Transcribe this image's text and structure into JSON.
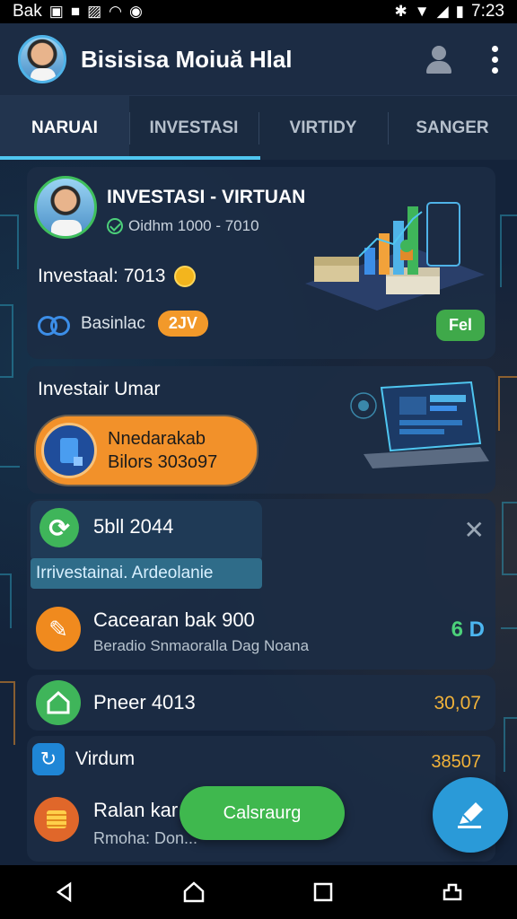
{
  "status_bar": {
    "carrier": "Bak",
    "time": "7:23"
  },
  "app_bar": {
    "title": "Bisisisa Moiuă Hlal"
  },
  "tabs": [
    {
      "label": "NARUAI",
      "active": true
    },
    {
      "label": "INVESTASI",
      "active": false
    },
    {
      "label": "VIRTIDY",
      "active": false
    },
    {
      "label": "SANGER",
      "active": false
    }
  ],
  "profile_card": {
    "title": "INVESTASI - VIRTUAN",
    "subtitle": "Oidhm 1000 - 7010",
    "amount": "Investaal: 7013",
    "bottom_label": "Basinlac",
    "orange_pill": "2JV",
    "green_pill": "Fel"
  },
  "invest_card": {
    "title": "Investair Umar",
    "button_line1": "Nnedarakab",
    "button_line2": "Bilors 303o97"
  },
  "activity_card": {
    "title": "5bll 2044",
    "banner": "Irrivestainai. Ardeolanie",
    "row_title": "Cacearan bak 900",
    "row_sub": "Beradio Snmaoralla Dag Noana",
    "badge_left": "6",
    "badge_right": "D"
  },
  "summary_row": {
    "label": "Pneer 4013",
    "value": "30,07"
  },
  "virdum_card": {
    "label": "Virdum",
    "value": "38507",
    "row_title": "Ralan kar",
    "row_sub": "Rmoha: Don..."
  },
  "fab": {
    "label": "Calsraurg"
  },
  "colors": {
    "background": "#14233a",
    "accent_blue": "#4fc6f0",
    "orange": "#f2912a",
    "green": "#3fb84e",
    "gold_value": "#f2b33a"
  }
}
